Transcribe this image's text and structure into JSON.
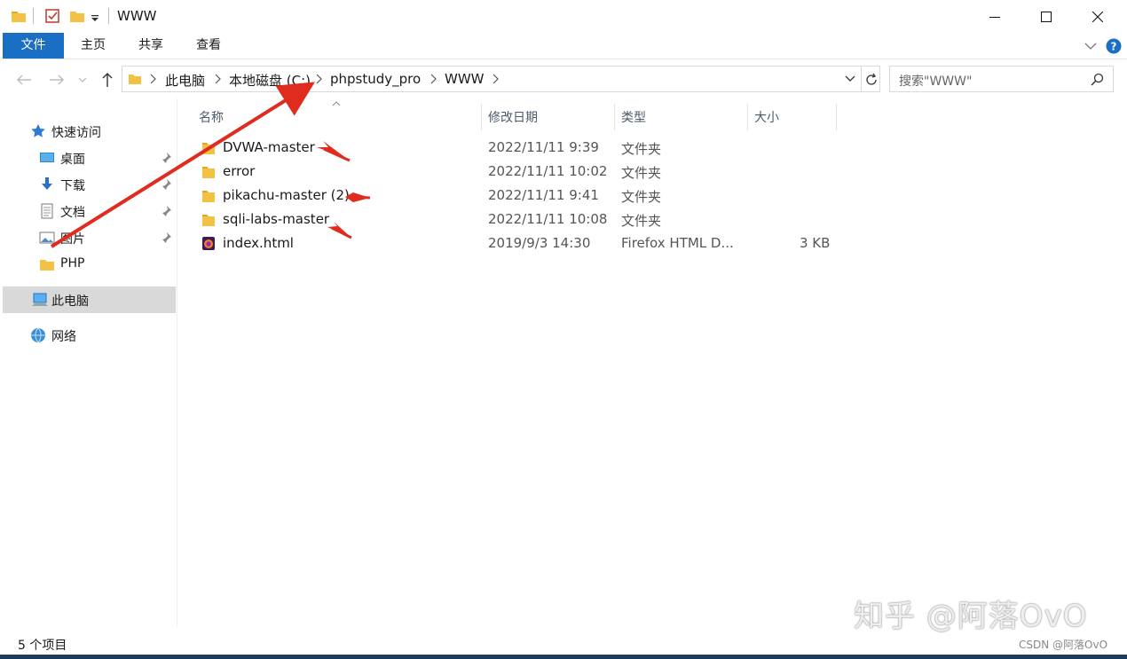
{
  "window": {
    "title": "WWW"
  },
  "ribbon": {
    "tabs": [
      "文件",
      "主页",
      "共享",
      "查看"
    ]
  },
  "address": {
    "crumbs": [
      "此电脑",
      "本地磁盘 (C:)",
      "phpstudy_pro",
      "WWW"
    ],
    "search_placeholder": "搜索\"WWW\""
  },
  "sidebar": {
    "quick_access": "快速访问",
    "pinned": [
      "桌面",
      "下载",
      "文档",
      "图片"
    ],
    "php": "PHP",
    "this_pc": "此电脑",
    "network": "网络"
  },
  "columns": {
    "name": "名称",
    "modified": "修改日期",
    "type": "类型",
    "size": "大小"
  },
  "files": [
    {
      "name": "DVWA-master",
      "modified": "2022/11/11 9:39",
      "type": "文件夹",
      "size": ""
    },
    {
      "name": "error",
      "modified": "2022/11/11 10:02",
      "type": "文件夹",
      "size": ""
    },
    {
      "name": "pikachu-master (2)",
      "modified": "2022/11/11 9:41",
      "type": "文件夹",
      "size": ""
    },
    {
      "name": "sqli-labs-master",
      "modified": "2022/11/11 10:08",
      "type": "文件夹",
      "size": ""
    },
    {
      "name": "index.html",
      "modified": "2019/9/3 14:30",
      "type": "Firefox HTML D...",
      "size": "3 KB"
    }
  ],
  "status": {
    "items": "5 个项目"
  },
  "watermark": {
    "zhihu": "知乎 @阿落OvO",
    "csdn": "CSDN @阿落OvO"
  },
  "colors": {
    "accent": "#1a6fc4",
    "folder": "#f3c244",
    "arrow": "#e02b1f"
  }
}
